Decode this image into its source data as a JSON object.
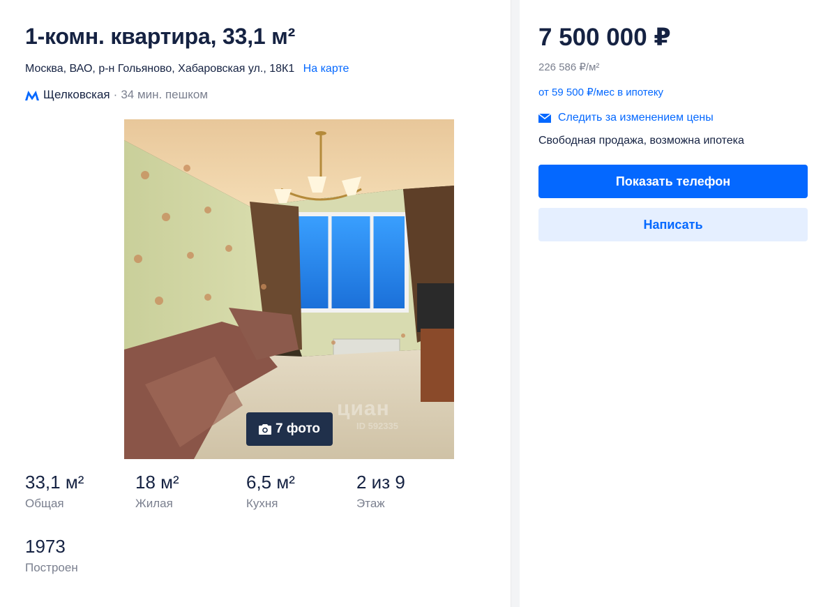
{
  "listing": {
    "title": "1-комн. квартира, 33,1 м²",
    "address": "Москва, ВАО, р-н Гольяново, Хабаровская ул., 18К1",
    "map_link": "На карте",
    "metro_station": "Щелковская",
    "metro_separator": "·",
    "metro_time": "34 мин. пешком",
    "metro_color": "#0468ff"
  },
  "photo": {
    "badge_label": "7 фото",
    "watermark": "циан",
    "watermark_id": "ID 592335"
  },
  "facts": [
    {
      "value": "33,1 м²",
      "label": "Общая"
    },
    {
      "value": "18 м²",
      "label": "Жилая"
    },
    {
      "value": "6,5 м²",
      "label": "Кухня"
    },
    {
      "value": "2 из 9",
      "label": "Этаж"
    },
    {
      "value": "1973",
      "label": "Построен"
    }
  ],
  "sidebar": {
    "price": "7 500 000 ₽",
    "price_per_m2": "226 586 ₽/м²",
    "mortgage": "от 59 500 ₽/мес в ипотеку",
    "track_price": "Следить за изменением цены",
    "sale_type": "Свободная продажа, возможна ипотека",
    "show_phone": "Показать телефон",
    "write": "Написать"
  },
  "colors": {
    "accent": "#0468ff",
    "text": "#152242",
    "muted": "#7a7f8e",
    "secondary_button_bg": "#e5efff"
  }
}
